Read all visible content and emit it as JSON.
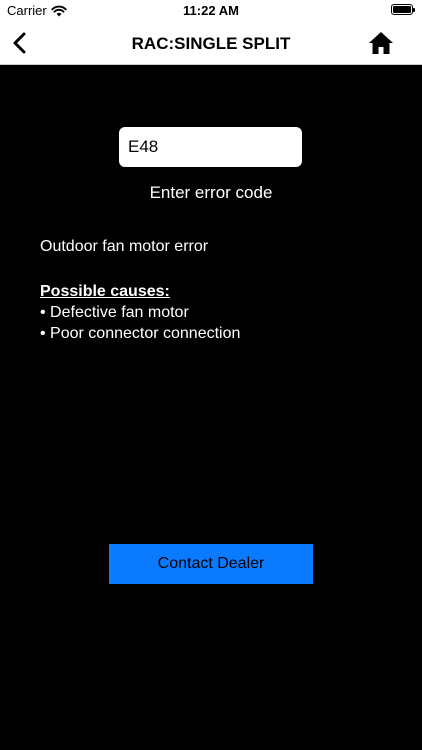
{
  "status_bar": {
    "carrier": "Carrier",
    "time": "11:22 AM"
  },
  "nav": {
    "title": "RAC:SINGLE SPLIT",
    "back_icon": "chevron-left-icon",
    "home_icon": "home-icon"
  },
  "error_lookup": {
    "code_value": "E48",
    "caption": "Enter error code"
  },
  "result": {
    "description": "Outdoor fan motor error",
    "causes_heading": "Possible causes:",
    "causes": [
      "• Defective fan motor",
      "• Poor connector connection"
    ]
  },
  "actions": {
    "contact_label": "Contact Dealer"
  },
  "colors": {
    "background": "#000000",
    "bar_background": "#ffffff",
    "accent": "#0a7aff",
    "text_light": "#ffffff"
  }
}
